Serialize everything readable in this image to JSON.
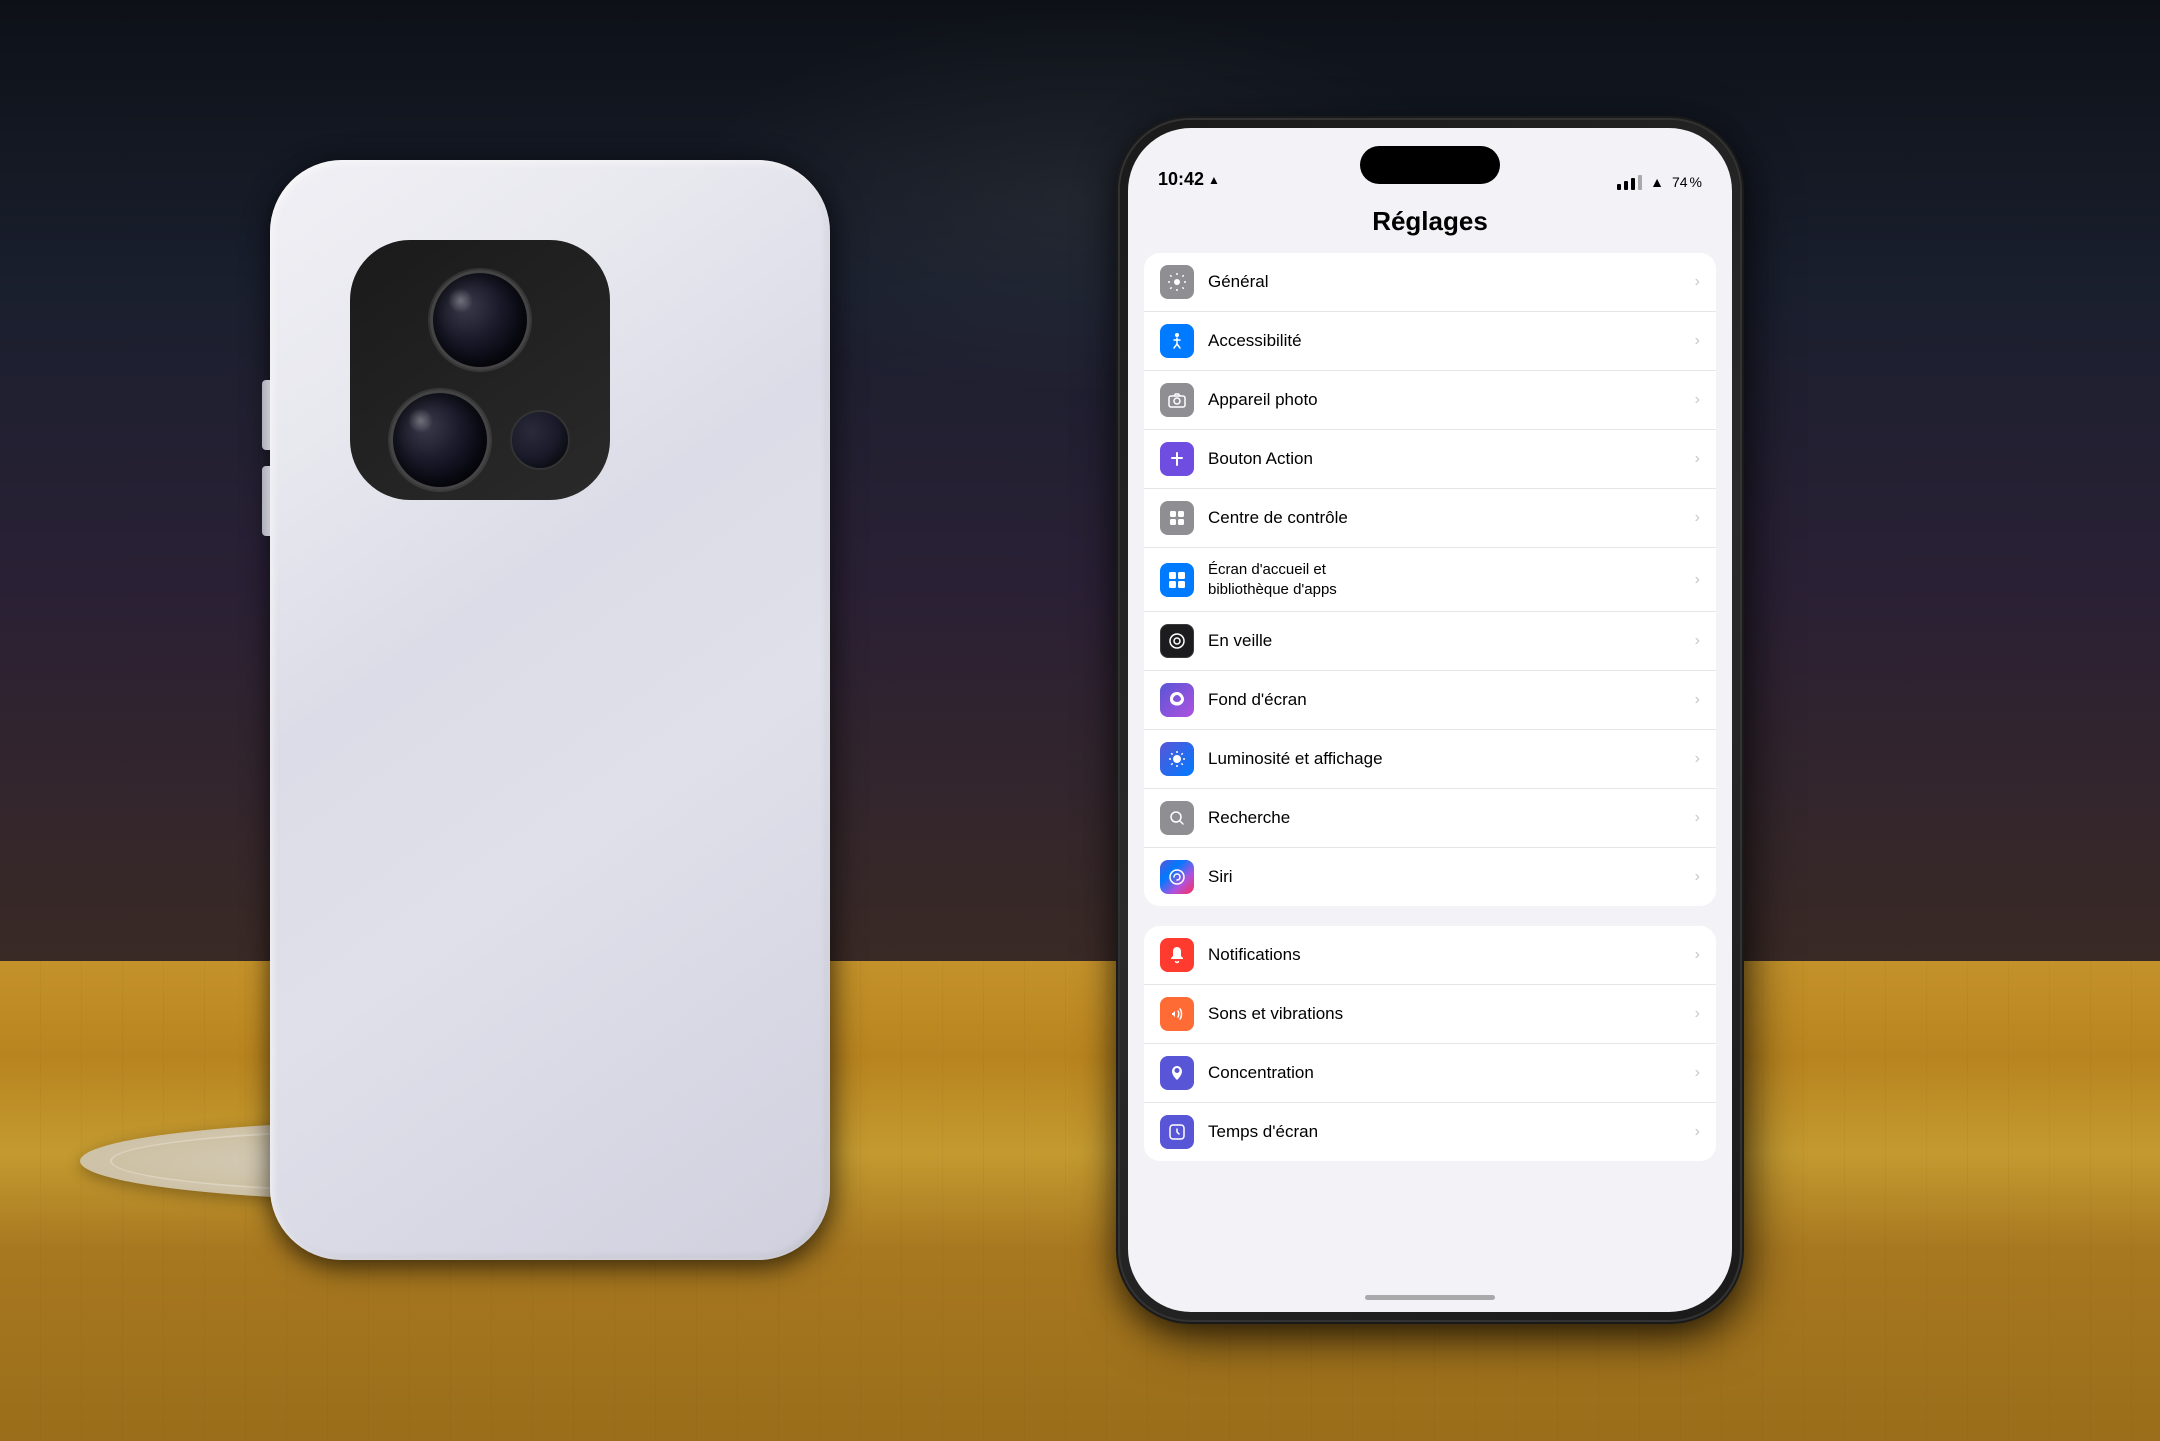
{
  "scene": {
    "background_color": "#1a1a2e"
  },
  "status_bar": {
    "time": "10:42",
    "location_icon": "▲",
    "battery": "74",
    "battery_suffix": "%"
  },
  "settings": {
    "title": "Réglages",
    "group1": [
      {
        "label": "Général",
        "icon_bg": "#8e8e93",
        "icon_symbol": "⚙️"
      },
      {
        "label": "Accessibilité",
        "icon_bg": "#007aff",
        "icon_symbol": "♿"
      },
      {
        "label": "Appareil photo",
        "icon_bg": "#8e8e93",
        "icon_symbol": "📷"
      },
      {
        "label": "Bouton Action",
        "icon_bg": "#6e4de0",
        "icon_symbol": "✚"
      },
      {
        "label": "Centre de contrôle",
        "icon_bg": "#8e8e93",
        "icon_symbol": "▦"
      },
      {
        "label": "Écran d'accueil et\nbibliothèque d'apps",
        "icon_bg": "#007aff",
        "icon_symbol": "▣"
      },
      {
        "label": "En veille",
        "icon_bg": "#1c1c1e",
        "icon_symbol": "◎"
      },
      {
        "label": "Fond d'écran",
        "icon_bg": "#5856d6",
        "icon_symbol": "✿"
      },
      {
        "label": "Luminosité et affichage",
        "icon_bg": "#5856d6",
        "icon_symbol": "✦"
      },
      {
        "label": "Recherche",
        "icon_bg": "#8e8e93",
        "icon_symbol": "🔍"
      },
      {
        "label": "Siri",
        "icon_bg": "gradient",
        "icon_symbol": "◎"
      }
    ],
    "group2": [
      {
        "label": "Notifications",
        "icon_bg": "#ff3b30",
        "icon_symbol": "🔔"
      },
      {
        "label": "Sons et vibrations",
        "icon_bg": "#ff3b30",
        "icon_symbol": "🔊"
      },
      {
        "label": "Concentration",
        "icon_bg": "#5856d6",
        "icon_symbol": "🌙"
      },
      {
        "label": "Temps d'écran",
        "icon_bg": "#5856d6",
        "icon_symbol": "⏱"
      }
    ]
  }
}
